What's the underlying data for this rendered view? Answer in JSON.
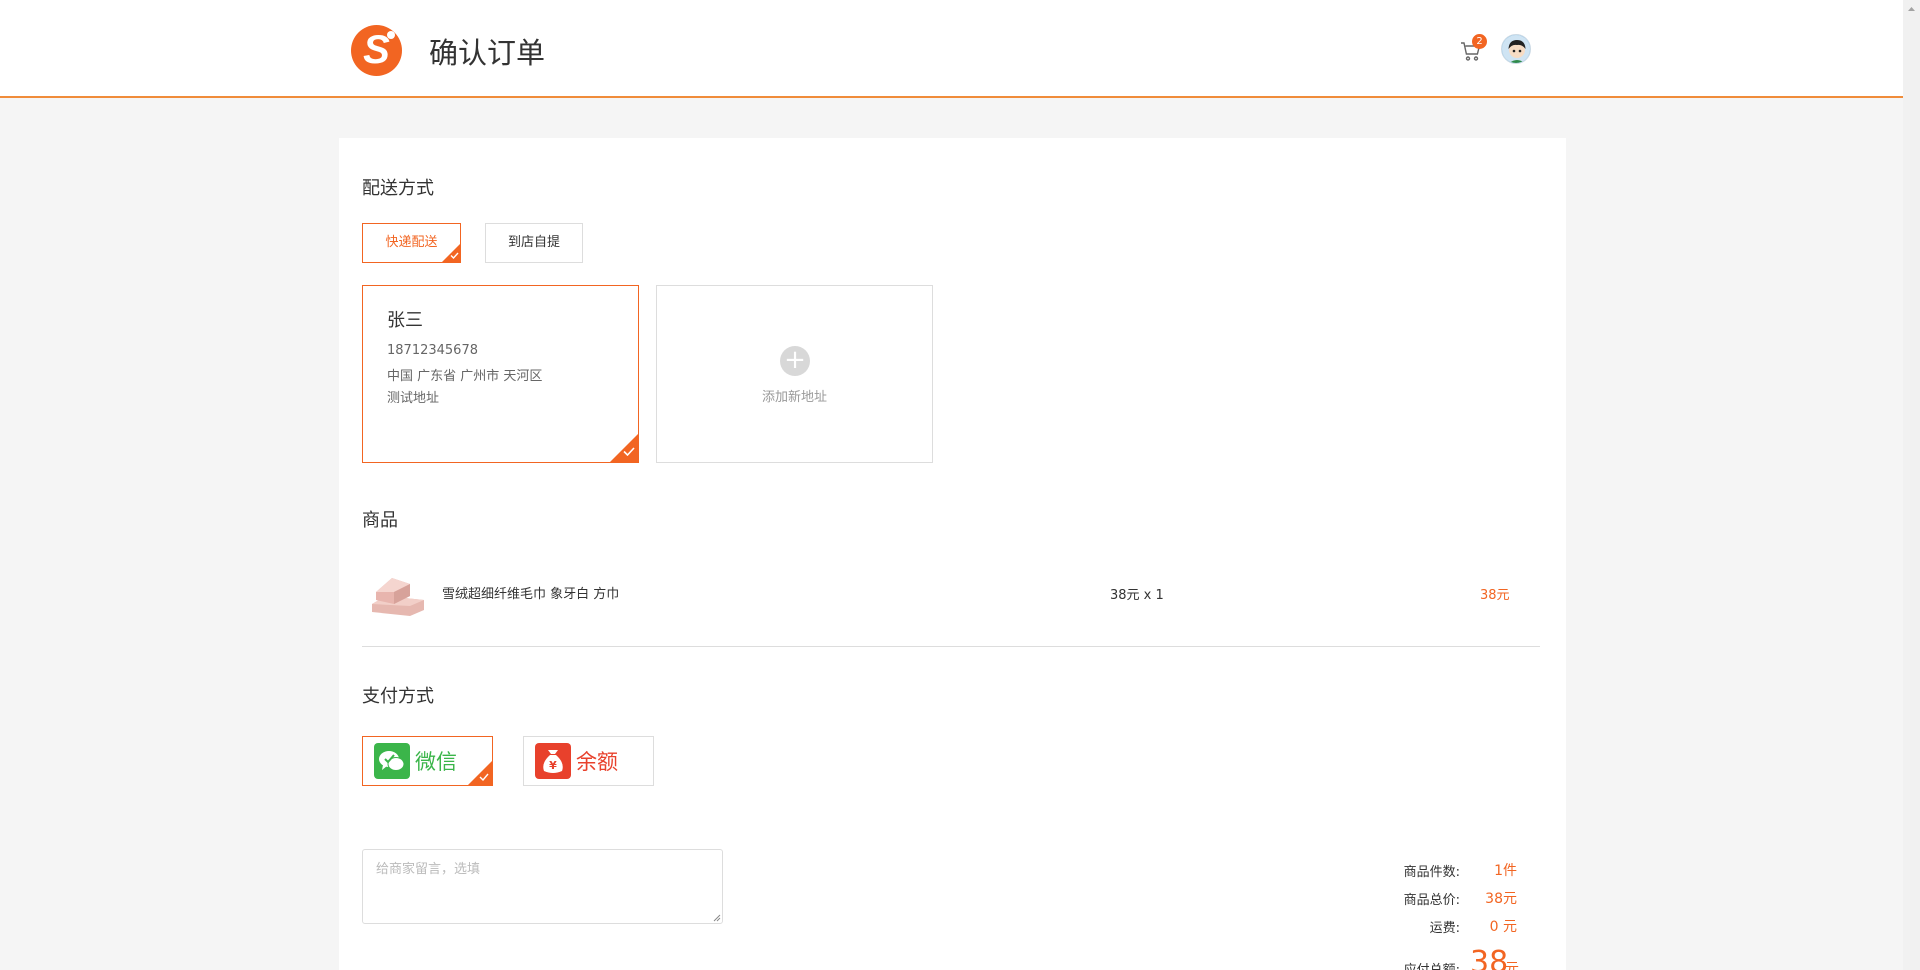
{
  "header": {
    "logo_letter": "S",
    "title": "确认订单",
    "cart_count": "2"
  },
  "delivery": {
    "title": "配送方式",
    "options": [
      "快递配送",
      "到店自提"
    ],
    "selected": "快递配送"
  },
  "address": {
    "name": "张三",
    "phone": "18712345678",
    "region": "中国 广东省 广州市 天河区",
    "detail": "测试地址",
    "add_label": "添加新地址"
  },
  "products": {
    "title": "商品",
    "items": [
      {
        "name": "雪绒超细纤维毛巾  象牙白 方巾",
        "qty_text": "38元 x 1",
        "total": "38元"
      }
    ]
  },
  "payment": {
    "title": "支付方式",
    "methods": [
      "微信",
      "余额"
    ],
    "selected": "微信"
  },
  "remark": {
    "placeholder": "给商家留言，选填"
  },
  "summary": {
    "count_label": "商品件数:",
    "count_value": "1件",
    "price_label": "商品总价:",
    "price_value": "38元",
    "shipping_label": "运费:",
    "shipping_value": "0 元",
    "payable_label": "应付总额:",
    "payable_value": "38",
    "payable_unit": "元"
  },
  "colors": {
    "accent": "#f26522",
    "header_border": "#f08c3a",
    "wechat_green": "#3bb54a",
    "balance_red": "#e8412c"
  }
}
